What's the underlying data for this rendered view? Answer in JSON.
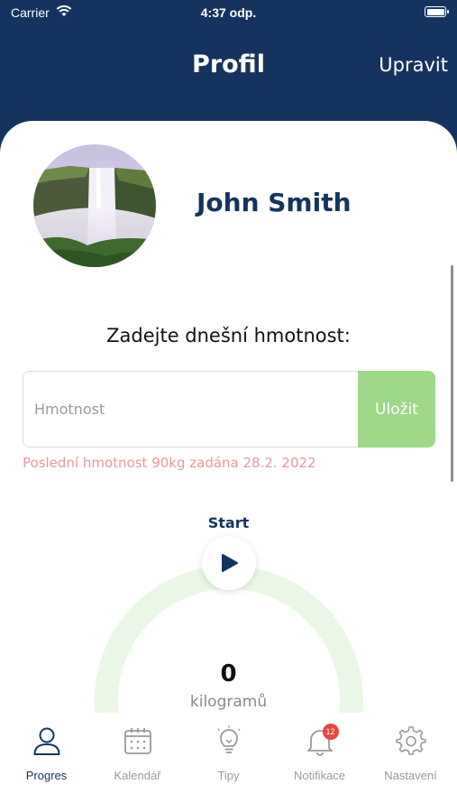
{
  "status_bar": {
    "carrier": "Carrier",
    "time": "4:37 odp."
  },
  "nav": {
    "title": "Profil",
    "edit_label": "Upravit"
  },
  "profile": {
    "name": "John Smith",
    "avatar_icon": "waterfall-photo"
  },
  "weight_form": {
    "prompt": "Zadejte dnešní hmotnost:",
    "placeholder": "Hmotnost",
    "value": "",
    "save_label": "Uložit",
    "last_weight_text": "Poslední hmotnost 90kg zadána 28.2. 2022"
  },
  "progress": {
    "start_label": "Start",
    "value": "0",
    "unit": "kilogramů"
  },
  "tabs": [
    {
      "label": "Progres",
      "icon": "user-icon",
      "active": true
    },
    {
      "label": "Kalendář",
      "icon": "calendar-icon",
      "active": false
    },
    {
      "label": "Tipy",
      "icon": "lightbulb-icon",
      "active": false
    },
    {
      "label": "Notifikace",
      "icon": "bell-icon",
      "active": false,
      "badge": "12"
    },
    {
      "label": "Nastavení",
      "icon": "gear-icon",
      "active": false
    }
  ],
  "colors": {
    "header": "#14345f",
    "save_button": "#9ed98a",
    "warning_text": "#e89a9a",
    "gauge_track": "#eaf7e6",
    "badge": "#e8463c"
  }
}
